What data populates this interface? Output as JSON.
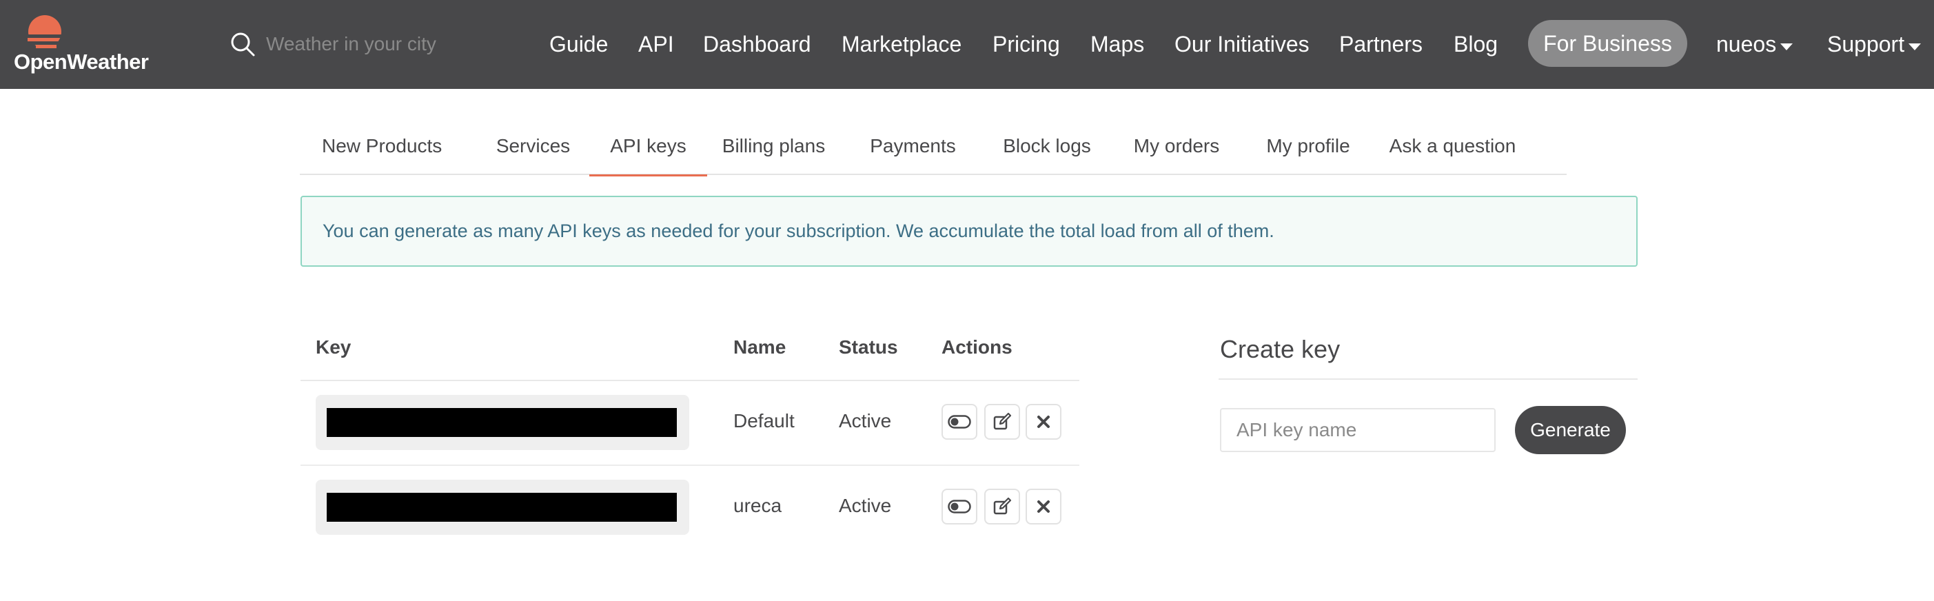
{
  "brand": {
    "name": "OpenWeather",
    "accent": "#e96e50",
    "nav_bg": "#48484a"
  },
  "search": {
    "placeholder": "Weather in your city",
    "value": "",
    "icon": "search-icon"
  },
  "nav": {
    "items": [
      "Guide",
      "API",
      "Dashboard",
      "Marketplace",
      "Pricing",
      "Maps",
      "Our Initiatives",
      "Partners",
      "Blog"
    ],
    "business": "For Business",
    "user": "nueos",
    "support": "Support"
  },
  "tabs": {
    "items": [
      "New Products",
      "Services",
      "API keys",
      "Billing plans",
      "Payments",
      "Block logs",
      "My orders",
      "My profile",
      "Ask a question"
    ],
    "active": "API keys"
  },
  "alert": {
    "text": "You can generate as many API keys as needed for your subscription. We accumulate the total load from all of them."
  },
  "keys_table": {
    "headers": {
      "key": "Key",
      "name": "Name",
      "status": "Status",
      "actions": "Actions"
    },
    "rows": [
      {
        "name": "Default",
        "status": "Active"
      },
      {
        "name": "ureca",
        "status": "Active"
      }
    ],
    "action_icons": [
      "toggle-icon",
      "edit-icon",
      "delete-icon"
    ]
  },
  "create_key": {
    "title": "Create key",
    "input_placeholder": "API key name",
    "input_value": "",
    "button": "Generate"
  }
}
